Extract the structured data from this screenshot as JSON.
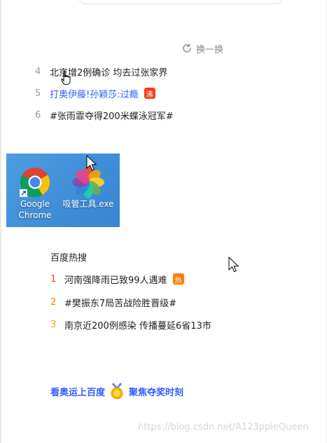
{
  "refresh": {
    "label": "换一换",
    "icon": "refresh-icon"
  },
  "hot_list": [
    {
      "rank": "4",
      "title": "北京增2例确诊 均去过张家界",
      "badge": ""
    },
    {
      "rank": "5",
      "title": "打奥伊藤!孙颖莎:过瘾",
      "badge": "沸"
    },
    {
      "rank": "6",
      "title": "#张雨霏夺得200米蝶泳冠军#",
      "badge": ""
    }
  ],
  "desktop": {
    "icons": [
      {
        "name": "google-chrome-icon",
        "label1": "Google",
        "label2": "Chrome"
      },
      {
        "name": "photos-flower-icon",
        "label1": "吸管工具.exe",
        "label2": ""
      }
    ]
  },
  "baidu_hot": {
    "title": "百度热搜",
    "items": [
      {
        "rank": "1",
        "title": "河南强降雨已致99人遇难",
        "badge": "热",
        "color": "#f0421f"
      },
      {
        "rank": "2",
        "title": "#樊振东7局苦战险胜晋级#",
        "badge": "",
        "color": "#ff7d00"
      },
      {
        "rank": "3",
        "title": "南京近200例感染 传播蔓延6省13市",
        "badge": "",
        "color": "#f5a623"
      }
    ]
  },
  "footer": {
    "left": "看奥运上百度",
    "right": "聚焦夺奖时刻",
    "icon": "gold-medal-icon"
  },
  "watermark": "https://blog.csdn.net/A123ppleQueen",
  "colors": {
    "link_blue": "#315efb",
    "desktop_blue": "#3f8ed8"
  }
}
